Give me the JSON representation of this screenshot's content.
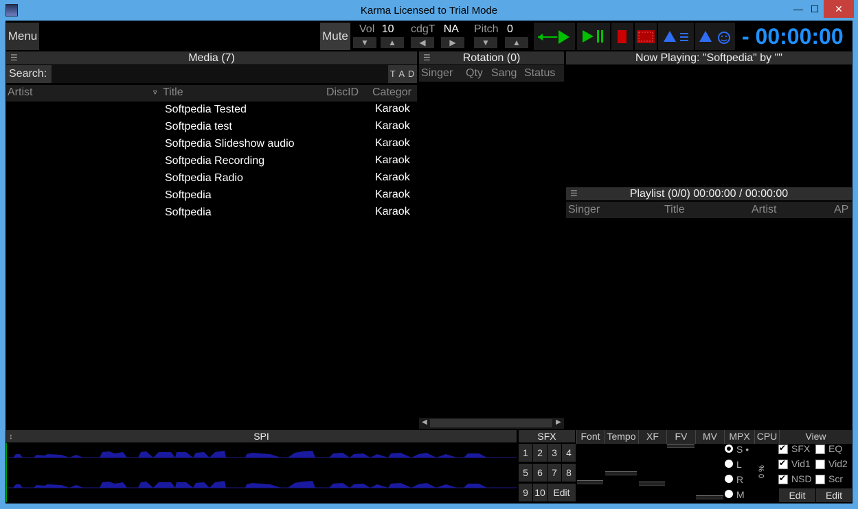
{
  "window": {
    "title": "Karma        Licensed to Trial Mode",
    "minimize": "—",
    "maximize": "☐",
    "close": "✕"
  },
  "toolbar": {
    "menu": "Menu",
    "mute": "Mute",
    "vol_label": "Vol",
    "vol_value": "10",
    "cdgt_label": "cdgT",
    "cdgt_value": "NA",
    "pitch_label": "Pitch",
    "pitch_value": "0",
    "down": "▼",
    "up": "▲",
    "left": "◀",
    "right": "▶",
    "timer": "- 00:00:00"
  },
  "media": {
    "header": "Media (7)",
    "search_label": "Search:",
    "tad": "T A D",
    "columns": {
      "artist": "Artist",
      "title": "Title",
      "discid": "DiscID",
      "category": "Categor"
    },
    "rows": [
      {
        "title": "Softpedia Tested",
        "category": "Karaok"
      },
      {
        "title": "Softpedia test",
        "category": "Karaok"
      },
      {
        "title": "Softpedia Slideshow audio",
        "category": "Karaok"
      },
      {
        "title": "Softpedia Recording",
        "category": "Karaok"
      },
      {
        "title": "Softpedia Radio",
        "category": "Karaok"
      },
      {
        "title": "Softpedia",
        "category": "Karaok"
      },
      {
        "title": "Softpedia",
        "category": "Karaok"
      }
    ]
  },
  "rotation": {
    "header": "Rotation (0)",
    "columns": {
      "singer": "Singer",
      "qty": "Qty",
      "sang": "Sang",
      "status": "Status"
    }
  },
  "now_playing": {
    "text": "Now Playing:  \"Softpedia\" by \"\""
  },
  "playlist": {
    "header": "Playlist (0/0)  00:00:00 / 00:00:00",
    "columns": {
      "singer": "Singer",
      "title": "Title",
      "artist": "Artist",
      "ap": "AP"
    }
  },
  "bottom": {
    "spi": "SPI",
    "sfx": "SFX",
    "numbers": [
      "1",
      "2",
      "3",
      "4",
      "5",
      "6",
      "7",
      "8",
      "9",
      "10"
    ],
    "edit": "Edit",
    "tools": [
      "Font",
      "Tempo",
      "XF",
      "FV",
      "MV",
      "MPX",
      "CPU"
    ],
    "view": "View",
    "radios": [
      "S •",
      "L",
      "R",
      "M"
    ],
    "percent": "0 %",
    "checks_left": [
      "SFX",
      "Vid1",
      "NSD"
    ],
    "checks_right": [
      "EQ",
      "Vid2",
      "Scr"
    ],
    "edit1": "Edit",
    "edit2": "Edit"
  },
  "colors": {
    "accent": "#1e90ff",
    "play_green": "#00c000",
    "stop_red": "#cc0000",
    "titlebar": "#5aa9e6"
  }
}
